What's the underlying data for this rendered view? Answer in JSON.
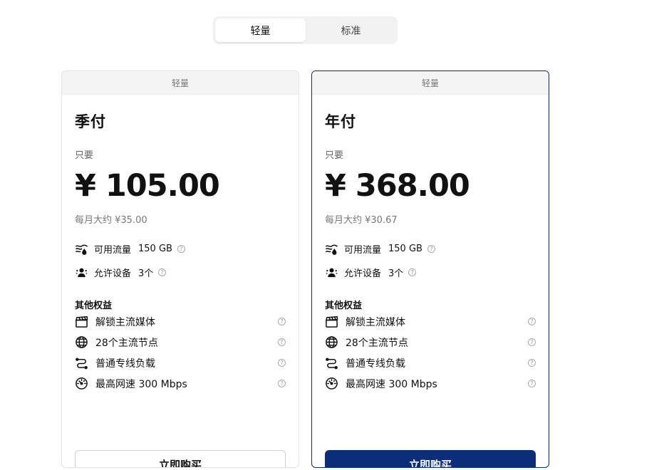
{
  "toggle": {
    "options": [
      "轻量",
      "标准"
    ],
    "selected": "轻量"
  },
  "common": {
    "only_label": "只要",
    "traffic_label": "可用流量",
    "devices_label": "允许设备",
    "other_benefits_title": "其他权益",
    "benefits": [
      {
        "icon": "clapperboard-icon",
        "text": "解锁主流媒体"
      },
      {
        "icon": "globe-icon",
        "text": "28个主流节点"
      },
      {
        "icon": "route-icon",
        "text": "普通专线负载"
      },
      {
        "icon": "speedometer-icon",
        "text": "最高网速 300 Mbps"
      }
    ],
    "buy_label": "立即购买"
  },
  "plans": [
    {
      "tier": "轻量",
      "name": "季付",
      "price": "¥ 105.00",
      "monthly": "每月大约 ¥35.00",
      "traffic": "150 GB",
      "devices": "3个",
      "button_style": "outline"
    },
    {
      "tier": "轻量",
      "name": "年付",
      "price": "¥ 368.00",
      "monthly": "每月大约 ¥30.67",
      "traffic": "150 GB",
      "devices": "3个",
      "button_style": "solid"
    }
  ],
  "colors": {
    "primary": "#0b2e7a",
    "selected_border": "#0b2e6f",
    "header_bg": "#f4f4f4"
  }
}
